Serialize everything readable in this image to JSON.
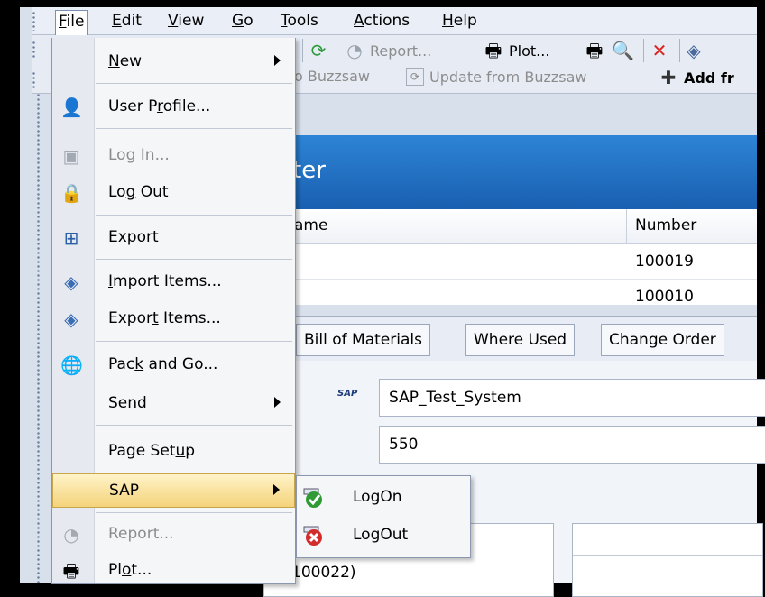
{
  "menubar": {
    "items": [
      {
        "pre": "",
        "ul": "F",
        "post": "ile"
      },
      {
        "pre": "",
        "ul": "E",
        "post": "dit"
      },
      {
        "pre": "",
        "ul": "V",
        "post": "iew"
      },
      {
        "pre": "",
        "ul": "G",
        "post": "o"
      },
      {
        "pre": "",
        "ul": "T",
        "post": "ools"
      },
      {
        "pre": "",
        "ul": "A",
        "post": "ctions"
      },
      {
        "pre": "",
        "ul": "H",
        "post": "elp"
      }
    ]
  },
  "toolbar": {
    "report": "Report...",
    "plot": "Plot...",
    "buzzsaw_partial": "o Buzzsaw",
    "update_buzzsaw": "Update from Buzzsaw",
    "add_partial": "Add fr"
  },
  "panel": {
    "title_partial": "ter",
    "col_name_partial": "ame",
    "col_number": "Number",
    "rows": [
      "100019",
      "100010"
    ]
  },
  "tabs": [
    "Bill of Materials",
    "Where Used",
    "Change Order"
  ],
  "form": {
    "sap_badge": "SAP",
    "system": "SAP_Test_System",
    "client": "550",
    "bottom_partial": "100022)"
  },
  "file_menu": {
    "new": {
      "pre": "",
      "ul": "N",
      "post": "ew"
    },
    "user_profile": {
      "pre": "User P",
      "ul": "r",
      "post": "ofile..."
    },
    "log_in": {
      "pre": "Log ",
      "ul": "I",
      "post": "n..."
    },
    "log_out": {
      "pre": "Lo",
      "ul": "g",
      "post": " Out"
    },
    "export": {
      "pre": "",
      "ul": "E",
      "post": "xport"
    },
    "import_items": {
      "pre": "",
      "ul": "I",
      "post": "mport Items..."
    },
    "export_items": {
      "pre": "Expor",
      "ul": "t",
      "post": " Items..."
    },
    "pack_and_go": {
      "pre": "Pac",
      "ul": "k",
      "post": " and Go..."
    },
    "send": {
      "pre": "Sen",
      "ul": "d",
      "post": ""
    },
    "page_setup": {
      "pre": "Page Set",
      "ul": "u",
      "post": "p"
    },
    "sap": {
      "pre": "SAP",
      "ul": "",
      "post": ""
    },
    "report": {
      "pre": "Report...",
      "ul": "",
      "post": ""
    },
    "plot": {
      "pre": "Pl",
      "ul": "o",
      "post": "t..."
    }
  },
  "sap_submenu": {
    "logon": "LogOn",
    "logout": "LogOut"
  },
  "colors": {
    "title_bar": "#1f6fc4",
    "highlight": "#f4d37a",
    "menu_bg": "#f5f6f8"
  }
}
